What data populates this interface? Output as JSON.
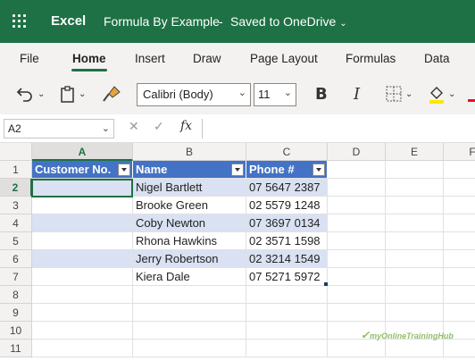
{
  "app": {
    "name": "Excel",
    "doc_title": "Formula By Example",
    "saved_status": "Saved to OneDrive",
    "accent": "#1e7145"
  },
  "tabs": [
    "File",
    "Home",
    "Insert",
    "Draw",
    "Page Layout",
    "Formulas",
    "Data"
  ],
  "active_tab": "Home",
  "toolbar": {
    "font": "Calibri (Body)",
    "size": "11",
    "bold_label": "B",
    "italic_label": "I"
  },
  "formula_bar": {
    "name_box": "A2",
    "fx_label": "fx",
    "formula": ""
  },
  "columns": [
    "A",
    "B",
    "C",
    "D",
    "E",
    "F"
  ],
  "rows": [
    "1",
    "2",
    "3",
    "4",
    "5",
    "6",
    "7",
    "8",
    "9",
    "10",
    "11"
  ],
  "table": {
    "headers": [
      "Customer No.",
      "Name",
      "Phone #"
    ],
    "rows": [
      [
        "",
        "Nigel Bartlett",
        "07 5647 2387"
      ],
      [
        "",
        "Brooke Green",
        "02 5579 1248"
      ],
      [
        "",
        "Coby Newton",
        "07 3697 0134"
      ],
      [
        "",
        "Rhona Hawkins",
        "02 3571 1598"
      ],
      [
        "",
        "Jerry Robertson",
        "02 3214 1549"
      ],
      [
        "",
        "Kiera Dale",
        "07 5271 5972"
      ]
    ],
    "header_color": "#4472c4",
    "band_color": "#d9e1f2"
  },
  "watermark": "myOnlineTrainingHub"
}
